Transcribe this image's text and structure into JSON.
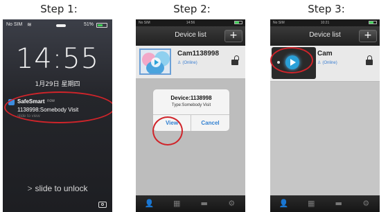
{
  "steps": [
    {
      "label": "Step 1:"
    },
    {
      "label": "Step 2:"
    },
    {
      "label": "Step 3:"
    }
  ],
  "lock_screen": {
    "carrier": "No SIM",
    "battery_pct": "51%",
    "time": "14:55",
    "date": "1月29日 星期四",
    "notification": {
      "app": "SafeSmart",
      "when": "now",
      "message": "1138998:Somebody Visit",
      "sub": "slide to view"
    },
    "slide_text": "slide to unlock",
    "slide_chevron": ">",
    "camera_icon": "camera-icon"
  },
  "app": {
    "carrier": "No SIM",
    "clock": "14:56",
    "nav_title": "Device list",
    "add_label": "+",
    "tabs": [
      {
        "icon": "person-icon",
        "glyph": "👤"
      },
      {
        "icon": "grid-icon",
        "glyph": "▦"
      },
      {
        "icon": "briefcase-icon",
        "glyph": "▬"
      },
      {
        "icon": "gear-icon",
        "glyph": "⚙"
      }
    ]
  },
  "step2": {
    "device_name": "Cam1138998",
    "device_status": "(Online)",
    "dialog": {
      "title": "Device:1138998",
      "type": "Type:Somebody Visit",
      "view_label": "View",
      "cancel_label": "Cancel"
    }
  },
  "step3": {
    "clock": "10:21",
    "device_name": "Cam",
    "device_status": "(Online)"
  },
  "colors": {
    "highlight_ring": "#d0242a",
    "accent_blue": "#2e8fe0",
    "online_blue": "#3a7dd0"
  }
}
